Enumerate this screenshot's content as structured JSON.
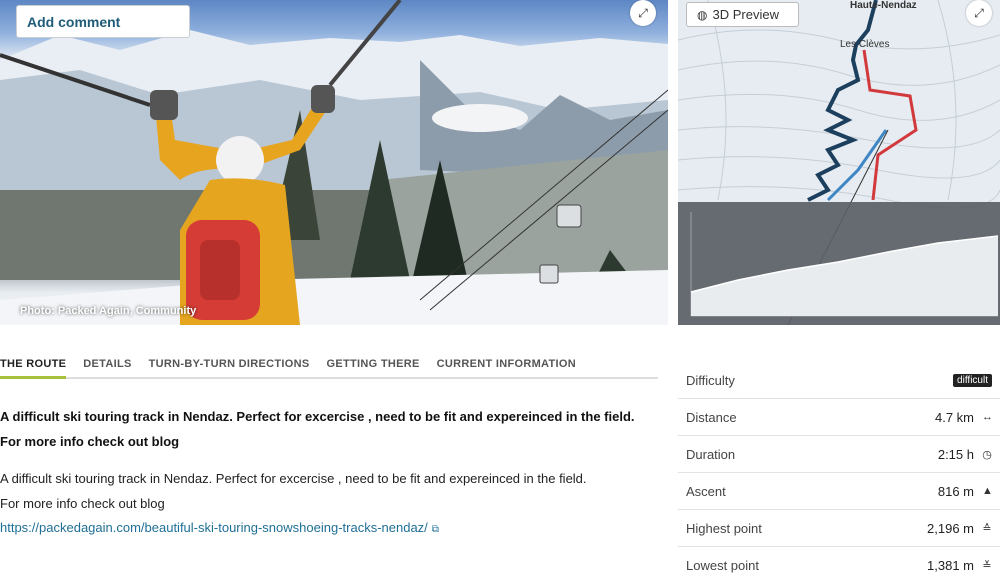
{
  "photo": {
    "add_comment_label": "Add comment",
    "credit": "Photo: Packed Again, Community",
    "expand_icon": "expand-icon"
  },
  "map": {
    "preview_label": "3D Preview",
    "place_labels": [
      "Haute-Nendaz",
      "Les Clèves"
    ],
    "route_colors": {
      "ascent": "#1d3f5e",
      "red": "#d2393d",
      "blue": "#3e86c4"
    }
  },
  "tabs": [
    {
      "label": "THE ROUTE",
      "active": true
    },
    {
      "label": "DETAILS"
    },
    {
      "label": "TURN-BY-TURN DIRECTIONS"
    },
    {
      "label": "GETTING THERE"
    },
    {
      "label": "CURRENT INFORMATION"
    }
  ],
  "route": {
    "lead_line1": "A difficult ski touring track in Nendaz. Perfect for excercise , need to be fit and expereinced in the field.",
    "lead_line2": "For more info check out blog",
    "body_line1": "A difficult ski touring track in Nendaz. Perfect for excercise , need to be fit and expereinced in the field.",
    "body_line2": "For more info check out blog",
    "link": "https://packedagain.com/beautiful-ski-touring-snowshoeing-tracks-nendaz/"
  },
  "stats": [
    {
      "label": "Difficulty",
      "value": "difficult",
      "badge": true
    },
    {
      "label": "Distance",
      "value": "4.7 km",
      "icon": "↔"
    },
    {
      "label": "Duration",
      "value": "2:15 h",
      "icon": "◷"
    },
    {
      "label": "Ascent",
      "value": "816 m",
      "icon": "▲"
    },
    {
      "label": "Highest point",
      "value": "2,196 m",
      "icon": "≙"
    },
    {
      "label": "Lowest point",
      "value": "1,381 m",
      "icon": "≚"
    }
  ]
}
